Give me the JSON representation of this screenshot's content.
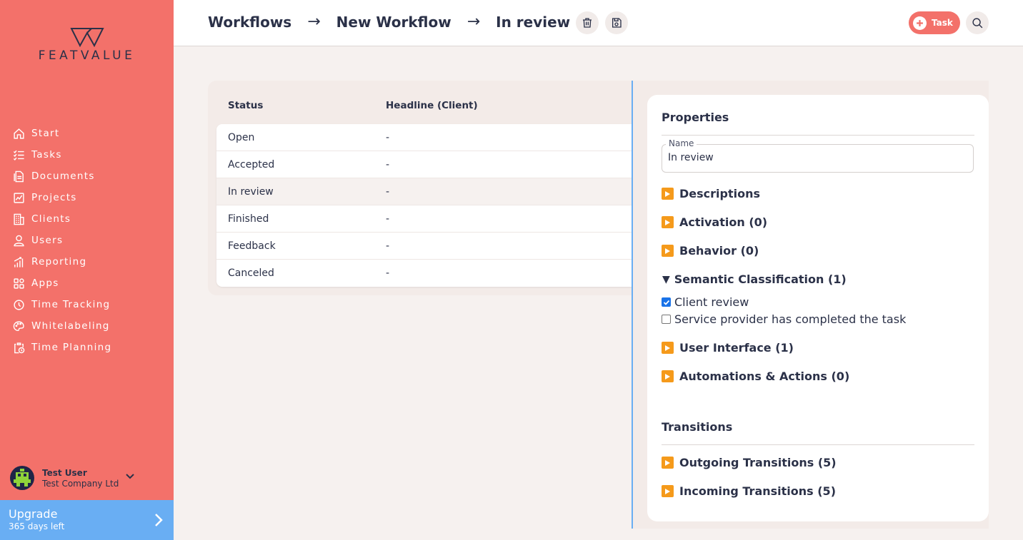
{
  "sidebar": {
    "logo_text": "FEATVALUE",
    "items": [
      {
        "label": "Start",
        "icon": "home-icon"
      },
      {
        "label": "Tasks",
        "icon": "tasks-icon"
      },
      {
        "label": "Documents",
        "icon": "document-icon"
      },
      {
        "label": "Projects",
        "icon": "projects-icon"
      },
      {
        "label": "Clients",
        "icon": "building-icon"
      },
      {
        "label": "Users",
        "icon": "user-icon"
      },
      {
        "label": "Reporting",
        "icon": "chart-icon"
      },
      {
        "label": "Apps",
        "icon": "apps-icon"
      },
      {
        "label": "Time Tracking",
        "icon": "timer-icon"
      },
      {
        "label": "Whitelabeling",
        "icon": "palette-icon"
      },
      {
        "label": "Time Planning",
        "icon": "clipboard-clock-icon"
      }
    ],
    "user": {
      "name": "Test User",
      "company": "Test Company Ltd"
    },
    "upgrade": {
      "title": "Upgrade",
      "subtitle": "365 days left"
    }
  },
  "header": {
    "breadcrumbs": [
      "Workflows",
      "New Workflow",
      "In review"
    ],
    "arrow": "→",
    "task_button": "Task"
  },
  "table": {
    "columns": [
      "Status",
      "Headline (Client)"
    ],
    "rows": [
      {
        "status": "Open",
        "headline": "-"
      },
      {
        "status": "Accepted",
        "headline": "-"
      },
      {
        "status": "In review",
        "headline": "-"
      },
      {
        "status": "Finished",
        "headline": "-"
      },
      {
        "status": "Feedback",
        "headline": "-"
      },
      {
        "status": "Canceled",
        "headline": "-"
      }
    ],
    "selected_index": 2
  },
  "properties": {
    "title": "Properties",
    "name_label": "Name",
    "name_value": "In review",
    "sections": {
      "descriptions": "Descriptions",
      "activation": "Activation (0)",
      "behavior": "Behavior (0)",
      "semantic": "Semantic Classification (1)",
      "user_interface": "User Interface (1)",
      "automations": "Automations & Actions (0)"
    },
    "checks": [
      {
        "label": "Client review",
        "checked": true
      },
      {
        "label": "Service provider has completed the task",
        "checked": false
      }
    ]
  },
  "transitions": {
    "title": "Transitions",
    "outgoing": "Outgoing Transitions (5)",
    "incoming": "Incoming Transitions (5)"
  },
  "colors": {
    "sidebar": "#f3716a",
    "accent_blue": "#69aef3",
    "accordion_icon": "#f59a1b",
    "text_dark": "#2b3148"
  }
}
